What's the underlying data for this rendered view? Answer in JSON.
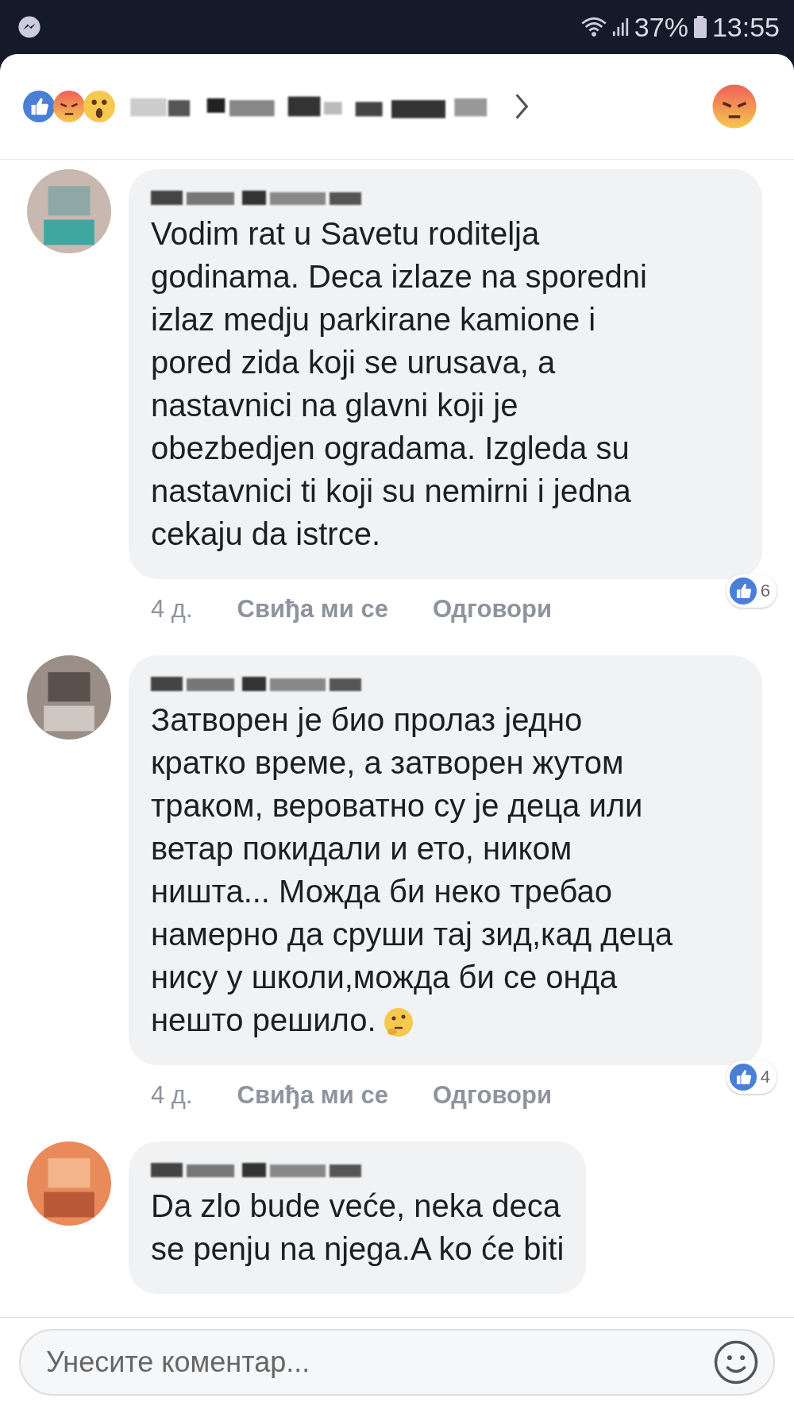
{
  "status_bar": {
    "battery": "37%",
    "time": "13:55"
  },
  "comments": [
    {
      "lines": [
        "Vodim rat u Savetu roditelja",
        "godinama. Deca izlaze na sporedni",
        "izlaz medju parkirane kamione i",
        "pored zida koji se urusava, a",
        "nastavnici na glavni koji je",
        "obezbedjen ogradama. Izgleda su",
        "nastavnici ti koji su nemirni i jedna",
        "cekaju da istrce."
      ],
      "emoji": false,
      "time": "4 д.",
      "like_label": "Свиђа ми се",
      "reply_label": "Одговори",
      "like_count": "6"
    },
    {
      "lines": [
        "Затворен је био пролаз једно",
        "кратко време, а затворен жутом",
        "траком, вероватно су је деца или",
        "ветар покидали и ето, ником",
        "ништа... Можда би неко требао",
        "намерно да сруши тај зид,кад деца",
        "нису у школи,можда би се онда",
        "нешто решило."
      ],
      "emoji": true,
      "time": "4 д.",
      "like_label": "Свиђа ми се",
      "reply_label": "Одговори",
      "like_count": "4"
    },
    {
      "lines": [
        "Da zlo bude veće, neka deca",
        "se penju na njega.A ko će  biti"
      ],
      "emoji": false
    }
  ],
  "composer": {
    "placeholder": "Унесите коментар..."
  }
}
